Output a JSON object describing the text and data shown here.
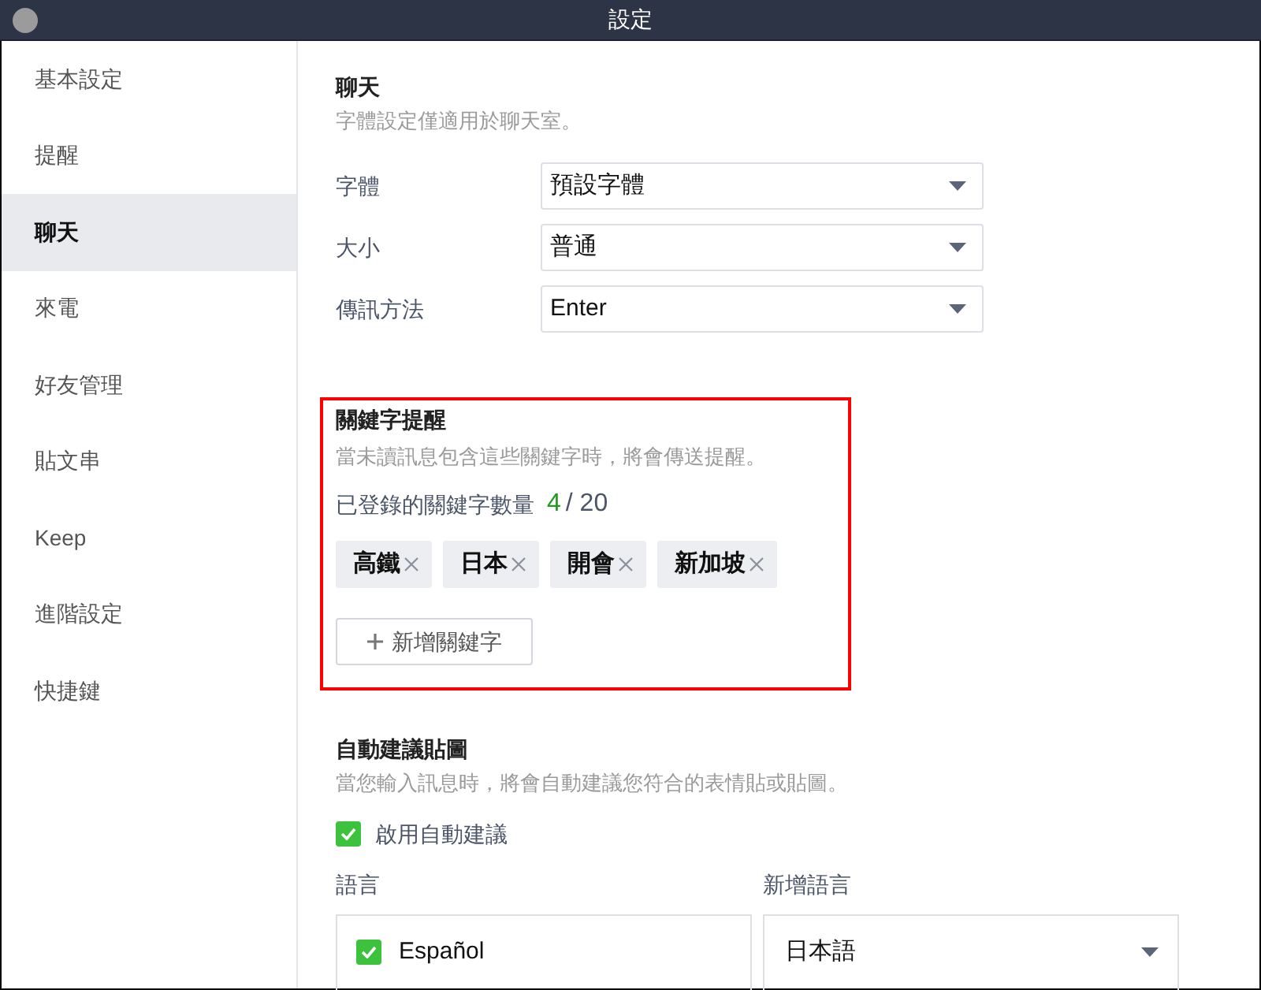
{
  "window": {
    "title": "設定"
  },
  "sidebar": {
    "items": [
      {
        "label": "基本設定",
        "selected": false
      },
      {
        "label": "提醒",
        "selected": false
      },
      {
        "label": "聊天",
        "selected": true
      },
      {
        "label": "來電",
        "selected": false
      },
      {
        "label": "好友管理",
        "selected": false
      },
      {
        "label": "貼文串",
        "selected": false
      },
      {
        "label": "Keep",
        "selected": false
      },
      {
        "label": "進階設定",
        "selected": false
      },
      {
        "label": "快捷鍵",
        "selected": false
      }
    ]
  },
  "chat": {
    "title": "聊天",
    "description": "字體設定僅適用於聊天室。",
    "settings": [
      {
        "label": "字體",
        "value": "預設字體"
      },
      {
        "label": "大小",
        "value": "普通"
      },
      {
        "label": "傳訊方法",
        "value": "Enter"
      }
    ]
  },
  "keyword_alert": {
    "highlighted": true,
    "title": "關鍵字提醒",
    "description": "當未讀訊息包含這些關鍵字時，將會傳送提醒。",
    "count_label": "已登錄的關鍵字數量",
    "count": "4",
    "limit": "/ 20",
    "keywords": [
      {
        "label": "高鐵"
      },
      {
        "label": "日本"
      },
      {
        "label": "開會"
      },
      {
        "label": "新加坡"
      }
    ],
    "add_button": "新增關鍵字"
  },
  "sticker_suggestions": {
    "title": "自動建議貼圖",
    "description": "當您輸入訊息時，將會自動建議您符合的表情貼或貼圖。",
    "enable": {
      "label": "啟用自動建議",
      "checked": true
    },
    "languages_label": "語言",
    "languages": [
      {
        "label": "Español",
        "checked": true
      }
    ],
    "add_language_label": "新增語言",
    "add_language_value": "日本語"
  }
}
